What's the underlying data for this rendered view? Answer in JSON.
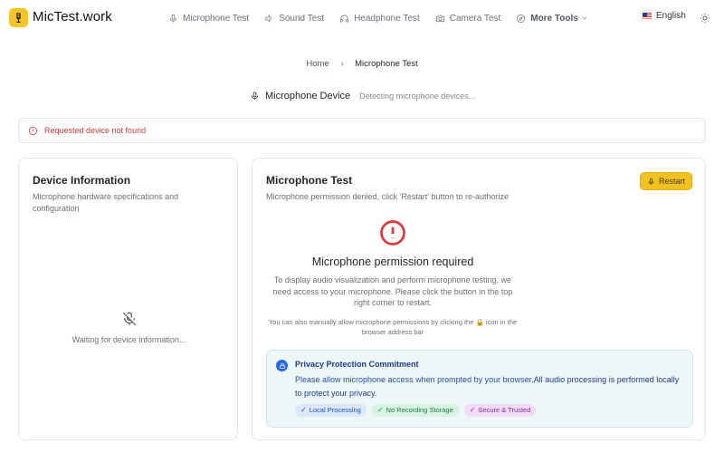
{
  "header": {
    "brand": "MicTest.work",
    "nav": [
      {
        "label": "Microphone Test",
        "icon": "microphone-icon"
      },
      {
        "label": "Sound Test",
        "icon": "speaker-icon"
      },
      {
        "label": "Headphone Test",
        "icon": "headphone-icon"
      },
      {
        "label": "Camera Test",
        "icon": "camera-icon"
      },
      {
        "label": "More Tools",
        "icon": "compass-icon"
      }
    ],
    "language": "English",
    "theme_icon": "sun-icon"
  },
  "breadcrumb": {
    "home": "Home",
    "separator": "›",
    "current": "Microphone Test"
  },
  "device": {
    "label": "Microphone Device",
    "status": "Detecting microphone devices..."
  },
  "alert": {
    "message": "Requested device not found",
    "color": "#d23a3a"
  },
  "device_info": {
    "title": "Device Information",
    "description": "Microphone hardware specifications and configuration",
    "waiting": "Waiting for device information..."
  },
  "mic_test": {
    "title": "Microphone Test",
    "description": "Microphone permission denied, click 'Restart' button to re-authorize",
    "restart_label": "Restart",
    "permission_title": "Microphone permission required",
    "permission_desc": "To display audio visualization and perform microphone testing, we need access to your microphone. Please click the button in the top right corner to restart.",
    "hint_before": "You can also manually allow microphone permissions by clicking the",
    "hint_lock": "🔒",
    "hint_after": "icon in the browser address bar"
  },
  "privacy": {
    "title": "Privacy Protection Commitment",
    "text_normal": "Please allow microphone access when prompted by your browser.",
    "text_bold": "All audio processing is performed locally to protect your privacy.",
    "badges": [
      {
        "label": "Local Processing",
        "color": "#1d4fb8"
      },
      {
        "label": "No Recording Storage",
        "color": "#1e7a45"
      },
      {
        "label": "Secure & Trusted",
        "color": "#8a2aa8"
      }
    ]
  },
  "colors": {
    "accent": "#f2c224",
    "error": "#dc3b3b",
    "privacy_bg": "#eef7f7"
  }
}
